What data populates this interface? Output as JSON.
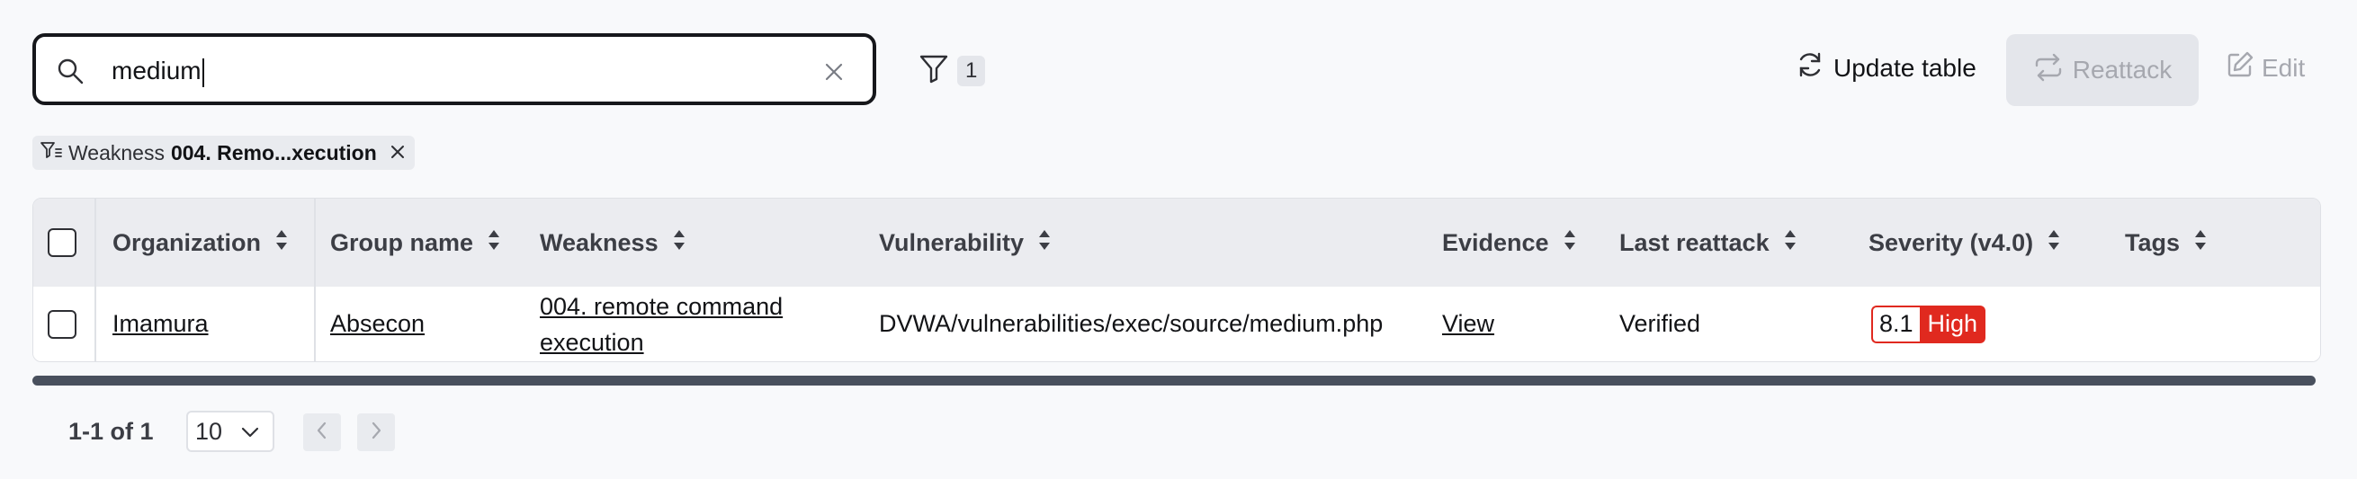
{
  "search": {
    "value": "medium"
  },
  "filters": {
    "count": "1"
  },
  "toolbar": {
    "update_label": "Update table",
    "reattack_label": "Reattack",
    "edit_label": "Edit"
  },
  "active_filter": {
    "label": "Weakness",
    "value": "004. Remo...xecution"
  },
  "table": {
    "columns": [
      "Organization",
      "Group name",
      "Weakness",
      "Vulnerability",
      "Evidence",
      "Last reattack",
      "Severity (v4.0)",
      "Tags"
    ],
    "rows": [
      {
        "organization": "Imamura",
        "group_name": "Absecon",
        "weakness_line1": "004. remote command",
        "weakness_line2": "execution",
        "vulnerability": "DVWA/vulnerabilities/exec/source/medium.php",
        "evidence": "View",
        "last_reattack": "Verified",
        "severity_score": "8.1",
        "severity_label": "High",
        "tags": ""
      }
    ]
  },
  "pagination": {
    "info": "1-1 of 1",
    "page_size": "10"
  },
  "colors": {
    "severity_high": "#e0291f",
    "accent_dark": "#16171b",
    "scrollbar": "#49505d"
  },
  "icons": [
    "search-icon",
    "clear-icon",
    "filter-icon",
    "refresh-icon",
    "reattack-icon",
    "edit-icon",
    "filter-list-icon",
    "close-icon",
    "sort-icon",
    "chevron-down-icon",
    "chevron-left-icon",
    "chevron-right-icon"
  ]
}
